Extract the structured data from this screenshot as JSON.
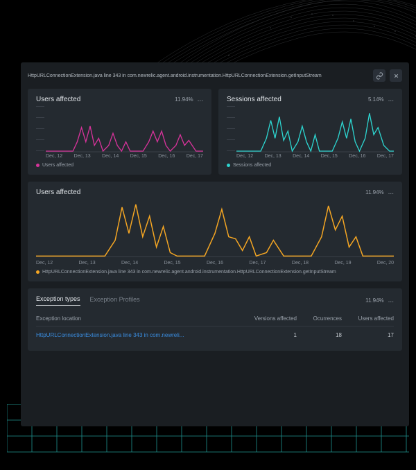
{
  "header": {
    "title": "HttpURLConnectionExtension.java line 343 in com.newrelic.agent.android.instrumentation.HttpURLConnectionExtension.getInputStream"
  },
  "cards": {
    "users": {
      "title": "Users affected",
      "pct": "11.94%",
      "legend": "Users affected",
      "color": "#d6339a",
      "xlabels": [
        "Dec, 12",
        "Dec, 13",
        "Dec, 14",
        "Dec, 15",
        "Dec, 16",
        "Dec, 17"
      ]
    },
    "sessions": {
      "title": "Sessions affected",
      "pct": "5.14%",
      "legend": "Sessions affected",
      "color": "#2dd4cf",
      "xlabels": [
        "Dec, 12",
        "Dec, 13",
        "Dec, 14",
        "Dec, 15",
        "Dec, 16",
        "Dec, 17"
      ]
    }
  },
  "big": {
    "title": "Users affected",
    "pct": "11.94%",
    "legend": "HttpURLConnectionExtension.java line 343 in com.newrelic.agent.android.instrumentation.HttpURLConnectionExtension.getInputStream",
    "color": "#f5a623",
    "xlabels": [
      "Dec, 12",
      "Dec, 13",
      "Dec, 14",
      "Dec, 15",
      "Dec, 16",
      "Dec, 17",
      "Dec, 18",
      "Dec, 19",
      "Dec, 20"
    ]
  },
  "table": {
    "tab1": "Exception types",
    "tab2": "Exception Profiles",
    "pct": "11.94%",
    "h0": "Exception location",
    "h1": "Versions affected",
    "h2": "Ocurrences",
    "h3": "Users affected",
    "r0c0": "HttpURLConnectionExtension.java line 343 in com.newreli...",
    "r0c1": "1",
    "r0c2": "18",
    "r0c3": "17"
  },
  "chart_data": [
    {
      "type": "line",
      "title": "Users affected",
      "xlabel": "",
      "ylabel": "",
      "categories": [
        "Dec, 12",
        "Dec, 13",
        "Dec, 14",
        "Dec, 15",
        "Dec, 16",
        "Dec, 17"
      ],
      "series": [
        {
          "name": "Users affected",
          "values_approx": "spiky series ranging 0–60% of y-range, unlabeled axis"
        }
      ],
      "ylim": [
        0,
        100
      ]
    },
    {
      "type": "line",
      "title": "Sessions affected",
      "xlabel": "",
      "ylabel": "",
      "categories": [
        "Dec, 12",
        "Dec, 13",
        "Dec, 14",
        "Dec, 15",
        "Dec, 16",
        "Dec, 17"
      ],
      "series": [
        {
          "name": "Sessions affected",
          "values_approx": "spiky series ranging 0–85% of y-range, unlabeled axis"
        }
      ],
      "ylim": [
        0,
        100
      ]
    },
    {
      "type": "line",
      "title": "Users affected",
      "xlabel": "",
      "ylabel": "",
      "categories": [
        "Dec, 12",
        "Dec, 13",
        "Dec, 14",
        "Dec, 15",
        "Dec, 16",
        "Dec, 17",
        "Dec, 18",
        "Dec, 19",
        "Dec, 20"
      ],
      "series": [
        {
          "name": "HttpURLConnectionExtension.java line 343",
          "values_approx": "spiky series, three main active clusters, 0–90% of y-range, unlabeled axis"
        }
      ],
      "ylim": [
        0,
        100
      ]
    }
  ]
}
